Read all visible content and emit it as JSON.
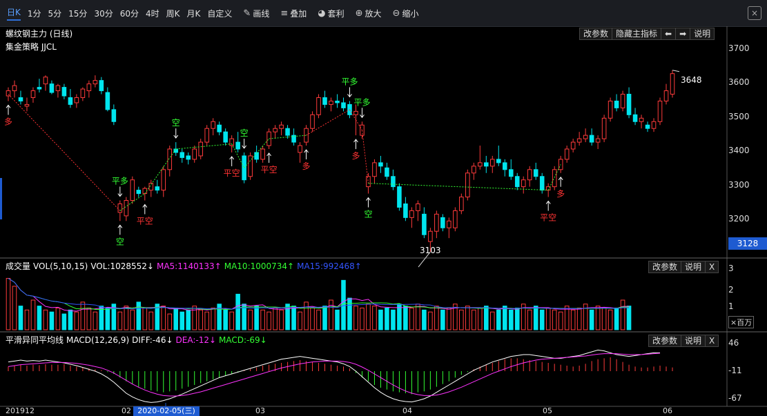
{
  "toolbar": {
    "periods": [
      "日K",
      "1分",
      "5分",
      "15分",
      "30分",
      "60分",
      "4时",
      "周K",
      "月K",
      "自定义"
    ],
    "tools": [
      {
        "icon": "pencil-icon",
        "glyph": "✎",
        "label": "画线"
      },
      {
        "icon": "stack-icon",
        "glyph": "≡",
        "label": "叠加"
      },
      {
        "icon": "moneybag-icon",
        "glyph": "◕",
        "label": "套利"
      },
      {
        "icon": "zoom-in-icon",
        "glyph": "⊕",
        "label": "放大"
      },
      {
        "icon": "zoom-out-icon",
        "glyph": "⊖",
        "label": "缩小"
      }
    ],
    "close": "×"
  },
  "main": {
    "title": "螺纹钢主力 (日线)",
    "strategy": "集金策略 JJCL",
    "buttons": [
      "改参数",
      "隐藏主指标",
      "⬅",
      "➡",
      "说明"
    ],
    "scale": [
      "3700",
      "3600",
      "3500",
      "3400",
      "3300",
      "3200"
    ],
    "current_price": "3128",
    "high_label": "3648",
    "low_label": "3103"
  },
  "volume": {
    "title": "成交量",
    "params": "VOL(5,10,15)",
    "vol": "VOL:1028552↓",
    "ma5": "MA5:1140133↑",
    "ma10": "MA10:1000734↑",
    "ma15": "MA15:992468↑",
    "buttons": [
      "改参数",
      "说明",
      "X"
    ],
    "scale": [
      "3",
      "2",
      "1"
    ],
    "unit": "×百万"
  },
  "macd": {
    "title": "平滑异同平均线",
    "params": "MACD(12,26,9)",
    "diff": "DIFF:-46↓",
    "dea": "DEA:-12↓",
    "macd": "MACD:-69↓",
    "buttons": [
      "改参数",
      "说明",
      "X"
    ],
    "scale": [
      "46",
      "-11",
      "-67"
    ]
  },
  "xaxis": {
    "labels": [
      "201912",
      "02",
      "03",
      "04",
      "05",
      "06"
    ],
    "cursor_date": "2020-02-05(三)"
  },
  "colors": {
    "up": "#ff3b3b",
    "down": "#00e5ee",
    "signal_green": "#33ff33",
    "signal_red": "#ff3333",
    "ma5": "#ff33ff",
    "ma10": "#33ff33",
    "ma15": "#3355ff",
    "accent": "#1e5bd1"
  },
  "chart_data": {
    "type": "candlestick",
    "title": "螺纹钢主力 (日线)",
    "ylim": [
      3100,
      3720
    ],
    "candles": [
      [
        3565,
        3590,
        3550,
        3580
      ],
      [
        3580,
        3610,
        3560,
        3595
      ],
      [
        3560,
        3580,
        3540,
        3550
      ],
      [
        3535,
        3560,
        3520,
        3540
      ],
      [
        3560,
        3590,
        3545,
        3580
      ],
      [
        3590,
        3615,
        3575,
        3585
      ],
      [
        3600,
        3625,
        3580,
        3620
      ],
      [
        3600,
        3610,
        3570,
        3575
      ],
      [
        3580,
        3600,
        3560,
        3595
      ],
      [
        3590,
        3600,
        3555,
        3565
      ],
      [
        3560,
        3585,
        3530,
        3540
      ],
      [
        3545,
        3570,
        3530,
        3560
      ],
      [
        3560,
        3590,
        3550,
        3585
      ],
      [
        3580,
        3610,
        3560,
        3600
      ],
      [
        3600,
        3625,
        3590,
        3610
      ],
      [
        3610,
        3620,
        3570,
        3580
      ],
      [
        3575,
        3590,
        3520,
        3525
      ],
      [
        3525,
        3540,
        3480,
        3490
      ],
      [
        3225,
        3260,
        3200,
        3250
      ],
      [
        3215,
        3270,
        3200,
        3260
      ],
      [
        3260,
        3330,
        3250,
        3320
      ],
      [
        3290,
        3300,
        3270,
        3280
      ],
      [
        3280,
        3300,
        3260,
        3295
      ],
      [
        3290,
        3320,
        3270,
        3310
      ],
      [
        3300,
        3320,
        3280,
        3290
      ],
      [
        3290,
        3360,
        3270,
        3350
      ],
      [
        3350,
        3420,
        3330,
        3410
      ],
      [
        3410,
        3430,
        3390,
        3400
      ],
      [
        3400,
        3410,
        3370,
        3385
      ],
      [
        3390,
        3400,
        3365,
        3380
      ],
      [
        3380,
        3420,
        3370,
        3410
      ],
      [
        3390,
        3440,
        3380,
        3430
      ],
      [
        3430,
        3480,
        3420,
        3470
      ],
      [
        3470,
        3500,
        3450,
        3490
      ],
      [
        3480,
        3490,
        3450,
        3460
      ],
      [
        3460,
        3470,
        3420,
        3430
      ],
      [
        3420,
        3450,
        3400,
        3440
      ],
      [
        3430,
        3460,
        3400,
        3410
      ],
      [
        3390,
        3400,
        3310,
        3320
      ],
      [
        3330,
        3400,
        3320,
        3390
      ],
      [
        3400,
        3420,
        3370,
        3380
      ],
      [
        3380,
        3420,
        3370,
        3410
      ],
      [
        3420,
        3470,
        3410,
        3460
      ],
      [
        3460,
        3480,
        3440,
        3470
      ],
      [
        3470,
        3490,
        3450,
        3480
      ],
      [
        3470,
        3480,
        3440,
        3450
      ],
      [
        3450,
        3470,
        3420,
        3430
      ],
      [
        3400,
        3430,
        3370,
        3420
      ],
      [
        3430,
        3480,
        3420,
        3470
      ],
      [
        3470,
        3520,
        3460,
        3510
      ],
      [
        3510,
        3570,
        3500,
        3560
      ],
      [
        3560,
        3580,
        3530,
        3540
      ],
      [
        3540,
        3560,
        3520,
        3550
      ],
      [
        3550,
        3570,
        3530,
        3545
      ],
      [
        3545,
        3560,
        3520,
        3530
      ],
      [
        3540,
        3550,
        3500,
        3510
      ],
      [
        3510,
        3540,
        3450,
        3520
      ],
      [
        3450,
        3490,
        3440,
        3480
      ],
      [
        3300,
        3340,
        3280,
        3330
      ],
      [
        3330,
        3380,
        3310,
        3370
      ],
      [
        3370,
        3390,
        3340,
        3360
      ],
      [
        3355,
        3370,
        3320,
        3330
      ],
      [
        3330,
        3350,
        3290,
        3300
      ],
      [
        3300,
        3310,
        3230,
        3240
      ],
      [
        3250,
        3270,
        3200,
        3210
      ],
      [
        3210,
        3240,
        3180,
        3230
      ],
      [
        3230,
        3260,
        3200,
        3250
      ],
      [
        3220,
        3240,
        3150,
        3160
      ],
      [
        3140,
        3180,
        3110,
        3170
      ],
      [
        3170,
        3230,
        3150,
        3220
      ],
      [
        3210,
        3220,
        3170,
        3180
      ],
      [
        3180,
        3210,
        3150,
        3200
      ],
      [
        3180,
        3240,
        3170,
        3230
      ],
      [
        3230,
        3280,
        3220,
        3270
      ],
      [
        3270,
        3350,
        3260,
        3340
      ],
      [
        3340,
        3370,
        3320,
        3360
      ],
      [
        3360,
        3420,
        3350,
        3370
      ],
      [
        3370,
        3390,
        3340,
        3360
      ],
      [
        3360,
        3390,
        3340,
        3380
      ],
      [
        3380,
        3420,
        3360,
        3370
      ],
      [
        3370,
        3380,
        3330,
        3350
      ],
      [
        3350,
        3380,
        3320,
        3330
      ],
      [
        3330,
        3340,
        3290,
        3300
      ],
      [
        3300,
        3330,
        3280,
        3320
      ],
      [
        3320,
        3360,
        3300,
        3350
      ],
      [
        3350,
        3370,
        3320,
        3330
      ],
      [
        3330,
        3340,
        3280,
        3290
      ],
      [
        3290,
        3310,
        3270,
        3300
      ],
      [
        3300,
        3360,
        3290,
        3350
      ],
      [
        3350,
        3390,
        3340,
        3380
      ],
      [
        3380,
        3420,
        3370,
        3410
      ],
      [
        3410,
        3440,
        3400,
        3430
      ],
      [
        3430,
        3460,
        3420,
        3440
      ],
      [
        3440,
        3470,
        3430,
        3450
      ],
      [
        3450,
        3470,
        3420,
        3430
      ],
      [
        3430,
        3450,
        3410,
        3440
      ],
      [
        3440,
        3510,
        3430,
        3500
      ],
      [
        3500,
        3560,
        3490,
        3550
      ],
      [
        3550,
        3570,
        3520,
        3530
      ],
      [
        3530,
        3580,
        3520,
        3570
      ],
      [
        3570,
        3590,
        3500,
        3510
      ],
      [
        3510,
        3530,
        3480,
        3490
      ],
      [
        3490,
        3510,
        3470,
        3500
      ],
      [
        3480,
        3490,
        3460,
        3470
      ],
      [
        3470,
        3500,
        3460,
        3490
      ],
      [
        3490,
        3560,
        3480,
        3550
      ],
      [
        3550,
        3600,
        3540,
        3580
      ],
      [
        3570,
        3640,
        3560,
        3630
      ]
    ],
    "signals": [
      {
        "i": 0,
        "text": "多",
        "side": "below",
        "color": "red"
      },
      {
        "i": 18,
        "text": "平多",
        "side": "above",
        "color": "green"
      },
      {
        "i": 18,
        "text": "空",
        "side": "below",
        "color": "green"
      },
      {
        "i": 22,
        "text": "平空",
        "side": "below",
        "color": "red"
      },
      {
        "i": 27,
        "text": "空",
        "side": "above",
        "color": "green"
      },
      {
        "i": 36,
        "text": "平空",
        "side": "below",
        "color": "red"
      },
      {
        "i": 38,
        "text": "空",
        "side": "above",
        "color": "green"
      },
      {
        "i": 42,
        "text": "平空",
        "side": "below",
        "color": "red"
      },
      {
        "i": 48,
        "text": "多",
        "side": "below",
        "color": "red"
      },
      {
        "i": 55,
        "text": "平多",
        "side": "above",
        "color": "green"
      },
      {
        "i": 56,
        "text": "多",
        "side": "below",
        "color": "red"
      },
      {
        "i": 57,
        "text": "平多",
        "side": "above",
        "color": "green"
      },
      {
        "i": 58,
        "text": "空",
        "side": "below",
        "color": "green"
      },
      {
        "i": 87,
        "text": "平空",
        "side": "below",
        "color": "red"
      },
      {
        "i": 89,
        "text": "多",
        "side": "below",
        "color": "red"
      }
    ],
    "volume": [
      2.6,
      2.2,
      1.2,
      1.0,
      1.5,
      1.2,
      1.0,
      0.9,
      1.1,
      0.8,
      1.0,
      0.9,
      1.4,
      1.1,
      0.9,
      1.2,
      1.1,
      1.3,
      0.9,
      1.2,
      1.0,
      1.4,
      1.1,
      0.9,
      1.3,
      1.2,
      0.8,
      1.1,
      0.9,
      1.0,
      1.2,
      1.0,
      0.9,
      1.1,
      1.3,
      1.0,
      0.9,
      1.8,
      1.3,
      1.0,
      1.2,
      1.0,
      0.9,
      1.1,
      1.0,
      1.3,
      1.2,
      0.9,
      1.4,
      1.1,
      1.0,
      1.2,
      1.5,
      1.0,
      2.5,
      1.6,
      1.2,
      1.1,
      1.3,
      1.2,
      1.0,
      1.1,
      1.0,
      1.3,
      1.2,
      1.1,
      1.3,
      1.0,
      0.9,
      1.2,
      1.0,
      1.1,
      1.3,
      1.0,
      1.2,
      1.0,
      1.1,
      1.2,
      0.9,
      1.0,
      1.2,
      1.0,
      1.1,
      1.3,
      1.0,
      1.2,
      1.0,
      1.1,
      1.0,
      0.9,
      1.2,
      1.0,
      1.1,
      1.3,
      1.0,
      1.2,
      1.1,
      1.0,
      1.1,
      1.5,
      1.2
    ],
    "macd_hist": [
      10,
      12,
      14,
      12,
      14,
      13,
      15,
      14,
      14,
      15,
      12,
      10,
      8,
      6,
      4,
      2,
      -2,
      -6,
      -14,
      -22,
      -28,
      -34,
      -38,
      -42,
      -44,
      -46,
      -44,
      -42,
      -38,
      -34,
      -30,
      -26,
      -22,
      -18,
      -14,
      -10,
      -6,
      -2,
      2,
      5,
      8,
      12,
      14,
      16,
      18,
      20,
      22,
      24,
      22,
      20,
      18,
      16,
      14,
      12,
      10,
      6,
      -4,
      -14,
      -22,
      -30,
      -36,
      -40,
      -44,
      -46,
      -48,
      -50,
      -46,
      -44,
      -40,
      -34,
      -28,
      -22,
      -14,
      -8,
      -2,
      4,
      10,
      14,
      18,
      22,
      26,
      28,
      28,
      26,
      24,
      22,
      20,
      18,
      16,
      14,
      12,
      10,
      12,
      16,
      22,
      26,
      28,
      30,
      26,
      20,
      14,
      10,
      8,
      8,
      10,
      12,
      10,
      8,
      10,
      12,
      10,
      10
    ],
    "macd_diff": [
      20,
      22,
      24,
      22,
      23,
      22,
      24,
      22,
      20,
      18,
      15,
      12,
      8,
      4,
      0,
      -6,
      -14,
      -24,
      -36,
      -48,
      -56,
      -62,
      -66,
      -68,
      -67,
      -64,
      -60,
      -55,
      -50,
      -44,
      -38,
      -32,
      -26,
      -20,
      -14,
      -10,
      -6,
      -2,
      2,
      6,
      10,
      14,
      18,
      22,
      26,
      28,
      30,
      32,
      30,
      28,
      26,
      24,
      22,
      20,
      16,
      10,
      0,
      -12,
      -24,
      -36,
      -46,
      -54,
      -60,
      -64,
      -66,
      -67,
      -64,
      -60,
      -54,
      -46,
      -38,
      -30,
      -22,
      -14,
      -6,
      2,
      8,
      14,
      20,
      24,
      28,
      32,
      34,
      36,
      36,
      34,
      32,
      30,
      28,
      28,
      30,
      32,
      34,
      38,
      42,
      46,
      44,
      40,
      36,
      34,
      32,
      34,
      36,
      38,
      40,
      40
    ],
    "macd_dea": [
      10,
      12,
      14,
      15,
      16,
      17,
      18,
      19,
      19,
      19,
      18,
      17,
      15,
      13,
      10,
      7,
      2,
      -4,
      -12,
      -20,
      -28,
      -35,
      -41,
      -46,
      -50,
      -53,
      -54,
      -54,
      -53,
      -51,
      -48,
      -45,
      -41,
      -37,
      -33,
      -29,
      -25,
      -21,
      -17,
      -13,
      -9,
      -5,
      -1,
      3,
      7,
      10,
      13,
      16,
      18,
      20,
      21,
      22,
      22,
      22,
      21,
      19,
      15,
      9,
      2,
      -6,
      -14,
      -22,
      -30,
      -37,
      -43,
      -48,
      -51,
      -53,
      -53,
      -52,
      -49,
      -45,
      -40,
      -35,
      -29,
      -23,
      -17,
      -11,
      -5,
      0,
      5,
      10,
      14,
      18,
      21,
      24,
      26,
      27,
      28,
      29,
      30,
      31,
      32,
      33,
      35,
      37,
      38,
      38,
      38,
      37,
      36,
      36,
      36,
      37,
      38,
      39
    ]
  }
}
